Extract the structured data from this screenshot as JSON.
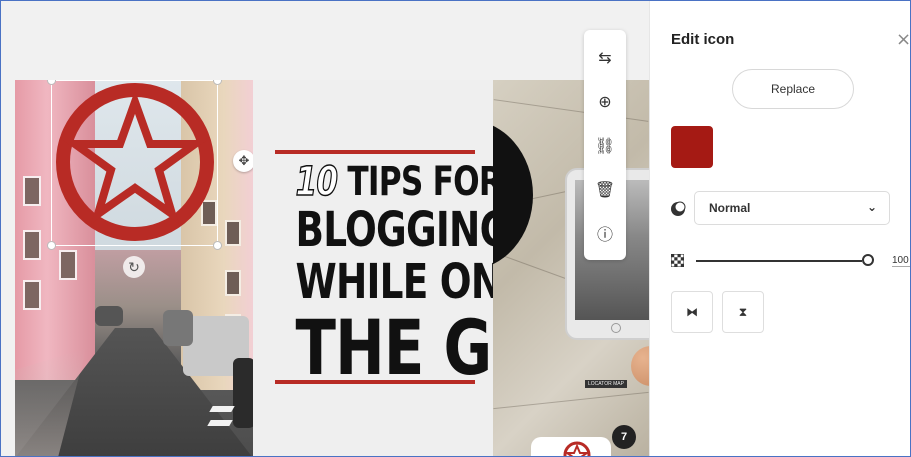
{
  "design": {
    "title_lines": [
      "10",
      "TIPS FOR",
      "BLOGGING",
      "WHILE ON",
      "THE GO"
    ],
    "icon": "star-in-circle-icon",
    "accent_color": "#b82b25",
    "map_label": "LOCATOR MAP"
  },
  "toolbar": {
    "items": [
      {
        "icon": "swap-icon",
        "glyph": "⇆"
      },
      {
        "icon": "duplicate-icon",
        "glyph": "⊕"
      },
      {
        "icon": "link-icon",
        "glyph": "⛓"
      },
      {
        "icon": "trash-icon",
        "glyph": "🗑"
      },
      {
        "icon": "info-icon",
        "glyph": "ⓘ"
      }
    ]
  },
  "page_badge": "7",
  "panel": {
    "title": "Edit icon",
    "close_glyph": "×",
    "replace_label": "Replace",
    "color": "#a51a14",
    "blend_mode": "Normal",
    "opacity": "100",
    "flip_horizontal_glyph": "⧓",
    "flip_vertical_glyph": "⧗"
  }
}
